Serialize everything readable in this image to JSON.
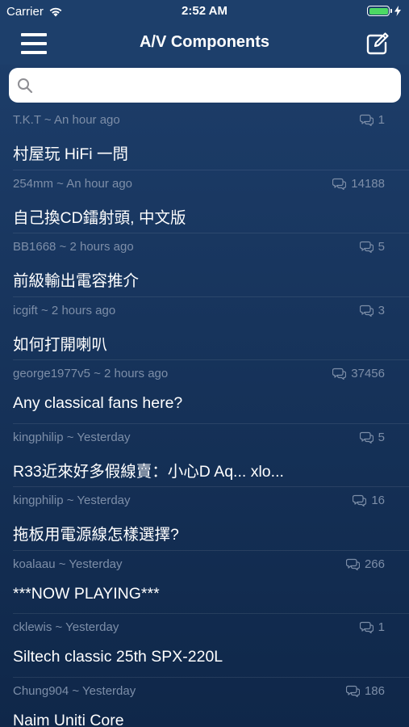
{
  "status_bar": {
    "carrier": "Carrier",
    "time": "2:52 AM",
    "battery_level": 1.0,
    "battery_color": "#4cd964"
  },
  "nav": {
    "title": "A/V Components",
    "left_icon": "hamburger-menu-icon",
    "right_icon": "compose-icon"
  },
  "search": {
    "placeholder": "",
    "value": "",
    "icon": "search-icon"
  },
  "colors": {
    "background_top": "#1e3f6c",
    "background_bottom": "#0f2749",
    "meta_text": "#7d8ea8",
    "title_text": "#ffffff"
  },
  "threads": [
    {
      "meta": "T.K.T ~ An hour ago",
      "replies": "1",
      "title": "村屋玩 HiFi 一問"
    },
    {
      "meta": "254mm ~ An hour ago",
      "replies": "14188",
      "title": "自己換CD鐳射頭, 中文版"
    },
    {
      "meta": "BB1668 ~ 2 hours ago",
      "replies": "5",
      "title": "前級輸出電容推介"
    },
    {
      "meta": "icgift ~ 2 hours ago",
      "replies": "3",
      "title": "如何打開喇叭"
    },
    {
      "meta": "george1977v5 ~ 2 hours ago",
      "replies": "37456",
      "title": "Any classical fans here?"
    },
    {
      "meta": "kingphilip ~ Yesterday",
      "replies": "5",
      "title": "R33近來好多假線賣：小心D  Aq... xlo..."
    },
    {
      "meta": "kingphilip ~ Yesterday",
      "replies": "16",
      "title": "拖板用電源線怎樣選擇?"
    },
    {
      "meta": "koalaau ~ Yesterday",
      "replies": "266",
      "title": "***NOW PLAYING***"
    },
    {
      "meta": "cklewis ~ Yesterday",
      "replies": "1",
      "title": "Siltech classic 25th SPX-220L"
    },
    {
      "meta": "Chung904 ~ Yesterday",
      "replies": "186",
      "title": "Naim Uniti Core"
    }
  ]
}
